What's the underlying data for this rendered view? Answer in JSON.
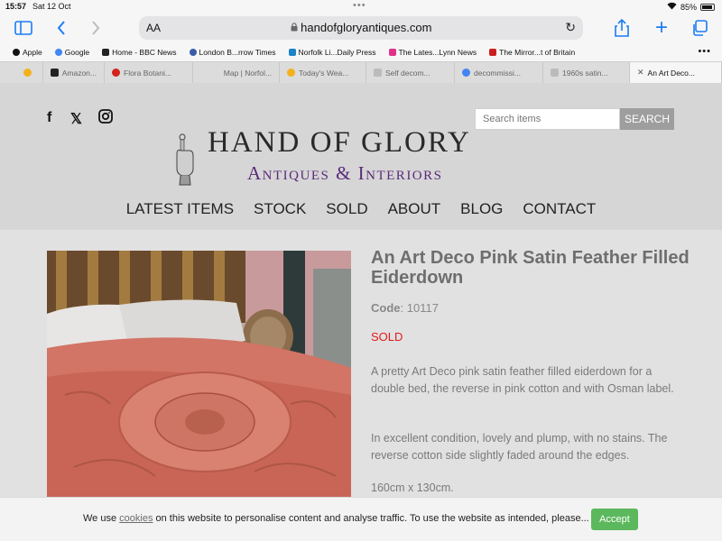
{
  "status_bar": {
    "time": "15:57",
    "date": "Sat 12 Oct",
    "battery": "85%"
  },
  "toolbar": {
    "text_size": "AA",
    "url": "handofgloryantiques.com"
  },
  "bookmarks": [
    {
      "label": "Apple",
      "color": "#111111"
    },
    {
      "label": "Google",
      "color": "#4285f4"
    },
    {
      "label": "Home - BBC News",
      "color": "#222222"
    },
    {
      "label": "London B...rrow Times",
      "color": "#3a5da8"
    },
    {
      "label": "Norfolk Li...Daily Press",
      "color": "#1a84c7"
    },
    {
      "label": "The Lates...Lynn News",
      "color": "#e0308a"
    },
    {
      "label": "The Mirror...t of Britain",
      "color": "#cc1f1f"
    }
  ],
  "tabs": [
    {
      "label": "",
      "color": "#f3b11c"
    },
    {
      "label": "Amazon...",
      "color": "#222222"
    },
    {
      "label": "Flora Botani...",
      "color": "#d3241f"
    },
    {
      "label": "Map | Norfol...",
      "color": "#cccccc"
    },
    {
      "label": "Today's Wea...",
      "color": "#f3b11c"
    },
    {
      "label": "Self decom...",
      "color": "#bbbbbb"
    },
    {
      "label": "decommissi...",
      "color": "#4285f4"
    },
    {
      "label": "1960s satin...",
      "color": "#bbbbbb"
    },
    {
      "label": "An Art Deco...",
      "color": "#888888"
    }
  ],
  "header": {
    "search_placeholder": "Search items",
    "search_button": "SEARCH",
    "logo_title": "HAND OF GLORY",
    "logo_subtitle": "Antiques & Interiors"
  },
  "nav": [
    "LATEST ITEMS",
    "STOCK",
    "SOLD",
    "ABOUT",
    "BLOG",
    "CONTACT"
  ],
  "product": {
    "title": "An Art Deco Pink Satin Feather Filled Eiderdown",
    "code_label": "Code",
    "code": "10117",
    "status": "SOLD",
    "description": [
      "A pretty Art Deco pink satin feather filled eiderdown for a double bed, the reverse in pink cotton and with Osman label.",
      "In excellent condition, lovely and plump, with no stains.  The reverse cotton side slightly faded around the edges.",
      "160cm x 130cm."
    ]
  },
  "cookie": {
    "prefix": "We use ",
    "link": "cookies",
    "suffix": " on this website to personalise content and analyse traffic. To use the website as intended, please...",
    "accept": "Accept"
  }
}
